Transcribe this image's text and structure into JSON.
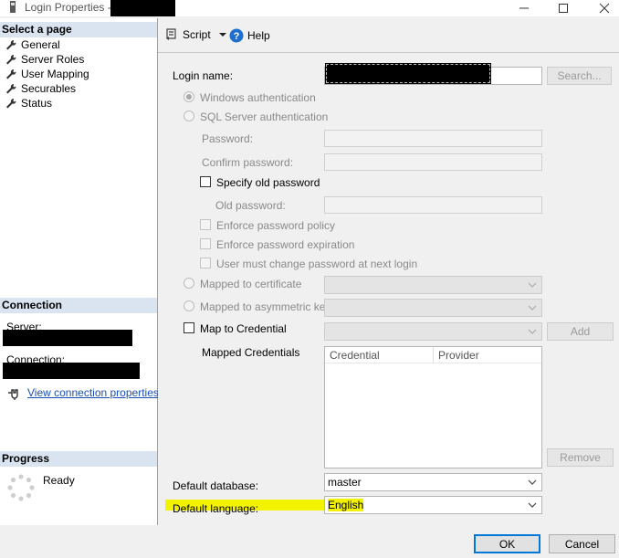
{
  "window": {
    "title": "Login Properties - "
  },
  "left": {
    "select_page_header": "Select a page",
    "pages": [
      {
        "label": "General",
        "icon": "wrench-icon"
      },
      {
        "label": "Server Roles",
        "icon": "wrench-icon"
      },
      {
        "label": "User Mapping",
        "icon": "wrench-icon"
      },
      {
        "label": "Securables",
        "icon": "wrench-icon"
      },
      {
        "label": "Status",
        "icon": "wrench-icon"
      }
    ],
    "connection_header": "Connection",
    "server_label": "Server:",
    "connection_label": "Connection:",
    "view_connection_link": "View connection properties",
    "progress_header": "Progress",
    "progress_status": "Ready"
  },
  "toolbar": {
    "script_label": "Script",
    "help_label": "Help"
  },
  "form": {
    "login_name_label": "Login name:",
    "search_button": "Search...",
    "windows_auth": "Windows authentication",
    "sql_auth": "SQL Server authentication",
    "password_label": "Password:",
    "confirm_password_label": "Confirm password:",
    "specify_old_password": "Specify old password",
    "old_password_label": "Old password:",
    "enforce_policy": "Enforce password policy",
    "enforce_expiration": "Enforce password expiration",
    "must_change": "User must change password at next login",
    "mapped_certificate": "Mapped to certificate",
    "mapped_asym_key": "Mapped to asymmetric key",
    "map_credential": "Map to Credential",
    "add_button": "Add",
    "mapped_credentials_label": "Mapped Credentials",
    "grid_columns": [
      "Credential",
      "Provider"
    ],
    "remove_button": "Remove",
    "default_database_label": "Default database:",
    "default_database_value": "master",
    "default_language_label": "Default language:",
    "default_language_value": "English"
  },
  "footer": {
    "ok": "OK",
    "cancel": "Cancel"
  },
  "colors": {
    "highlight": "#f3f300",
    "link": "#1a4fb5",
    "section_header": "#dae4f1"
  }
}
